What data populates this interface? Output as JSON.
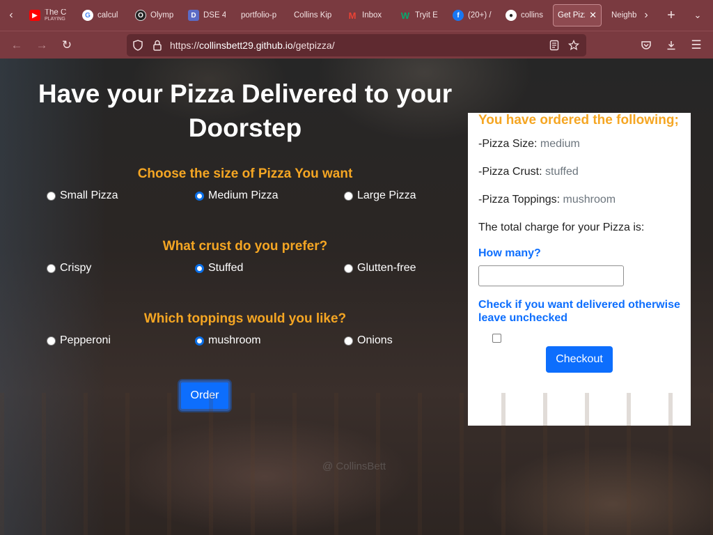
{
  "browser": {
    "tabs": [
      {
        "subtitle": "PLAYING",
        "label": "The C",
        "icon": "youtube-icon",
        "color": "#ff0000"
      },
      {
        "label": "calcul",
        "icon": "google-icon",
        "color": "#ffffff"
      },
      {
        "label": "Olymp",
        "icon": "olympus-icon",
        "color": "#222222"
      },
      {
        "label": "DSE 4",
        "icon": "dse-icon",
        "color": "#5b6bc6"
      },
      {
        "label": "portfolio-p",
        "icon": "",
        "color": ""
      },
      {
        "label": "Collins Kip",
        "icon": "",
        "color": ""
      },
      {
        "label": "Inbox",
        "icon": "gmail-icon",
        "color": "#ea4335"
      },
      {
        "label": "Tryit E",
        "icon": "w3schools-icon",
        "color": "#04aa6d"
      },
      {
        "label": "(20+) /",
        "icon": "facebook-icon",
        "color": "#1877f2"
      },
      {
        "label": "collins",
        "icon": "github-icon",
        "color": "#ffffff"
      },
      {
        "label": "Get Pizz",
        "icon": "",
        "color": "",
        "active": true
      },
      {
        "label": "Neighb",
        "icon": "",
        "color": ""
      }
    ],
    "url_prefix": "https://",
    "url_host": "collinsbett29.github.io",
    "url_path": "/getpizza/"
  },
  "page": {
    "title": "Have your Pizza Delivered to your Doorstep",
    "size_question": "Choose the size of Pizza You want",
    "size_options": [
      "Small Pizza",
      "Medium Pizza",
      "Large Pizza"
    ],
    "size_selected": "Medium Pizza",
    "crust_question": "What crust do you prefer?",
    "crust_options": [
      "Crispy",
      "Stuffed",
      "Glutten-free"
    ],
    "crust_selected": "Stuffed",
    "toppings_question": "Which toppings would you like?",
    "toppings_options": [
      "Pepperoni",
      "mushroom",
      "Onions"
    ],
    "toppings_selected": "mushroom",
    "order_label": "Order",
    "footer": "@ CollinsBett"
  },
  "summary": {
    "heading": "You have ordered the following;",
    "size_label": "-Pizza Size: ",
    "size_value": "medium",
    "crust_label": "-Pizza Crust: ",
    "crust_value": "stuffed",
    "toppings_label": "-Pizza Toppings: ",
    "toppings_value": "mushroom",
    "total_label": "The total charge for your Pizza is:",
    "how_many_label": "How many?",
    "how_many_value": "",
    "delivery_label": "Check if you want delivered otherwise leave unchecked",
    "delivery_checked": false,
    "checkout_label": "Checkout"
  },
  "colors": {
    "accent_orange": "#f5a623",
    "accent_blue": "#0d6efd",
    "browser_chrome": "#7a3a40"
  }
}
